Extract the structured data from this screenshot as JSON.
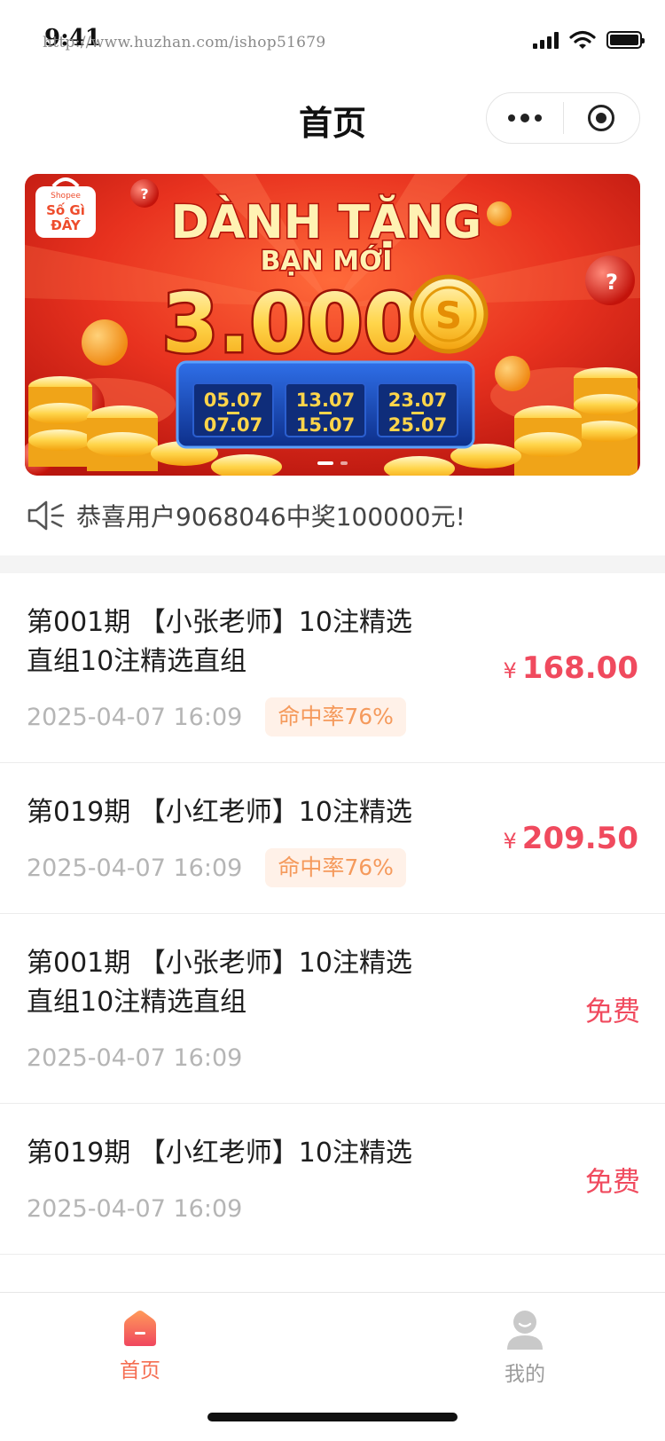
{
  "status_bar": {
    "time": "9:41",
    "watermark": "http://www.huzhan.com/ishop51679"
  },
  "nav": {
    "title": "首页"
  },
  "banner": {
    "brand_top": "Shopee",
    "brand_line1": "Số Gì",
    "brand_line2": "ĐÂY",
    "headline": "DÀNH TẶNG",
    "subline": "BẠN MỚI",
    "amount": "3.000",
    "coin_symbol": "S",
    "dates": [
      {
        "from": "05.07",
        "to": "07.07"
      },
      {
        "from": "13.07",
        "to": "15.07"
      },
      {
        "from": "23.07",
        "to": "25.07"
      }
    ]
  },
  "notice": {
    "text": "恭喜用户9068046中奖100000元!"
  },
  "items": [
    {
      "line1": "第001期 【小张老师】10注精选",
      "line2": "直组10注精选直组",
      "date": "2025-04-07 16:09",
      "badge": "命中率76%",
      "currency": "¥",
      "price": "168.00",
      "free": ""
    },
    {
      "line1": "第019期 【小红老师】10注精选",
      "line2": "",
      "date": "2025-04-07 16:09",
      "badge": "命中率76%",
      "currency": "¥",
      "price": "209.50",
      "free": ""
    },
    {
      "line1": "第001期 【小张老师】10注精选",
      "line2": "直组10注精选直组",
      "date": "2025-04-07 16:09",
      "badge": "",
      "currency": "",
      "price": "",
      "free": "免费"
    },
    {
      "line1": "第019期 【小红老师】10注精选",
      "line2": "",
      "date": "2025-04-07 16:09",
      "badge": "",
      "currency": "",
      "price": "",
      "free": "免费"
    }
  ],
  "tabs": {
    "home": "首页",
    "mine": "我的"
  },
  "colors": {
    "accent": "#f04a5e",
    "tab_active": "#f56e52",
    "badge_bg": "#fff1e8",
    "badge_text": "#f59a5c"
  },
  "icons": {
    "notice": "speaker-icon",
    "home": "home-icon",
    "mine": "user-icon",
    "more": "more-dots-icon",
    "close": "target-icon"
  }
}
